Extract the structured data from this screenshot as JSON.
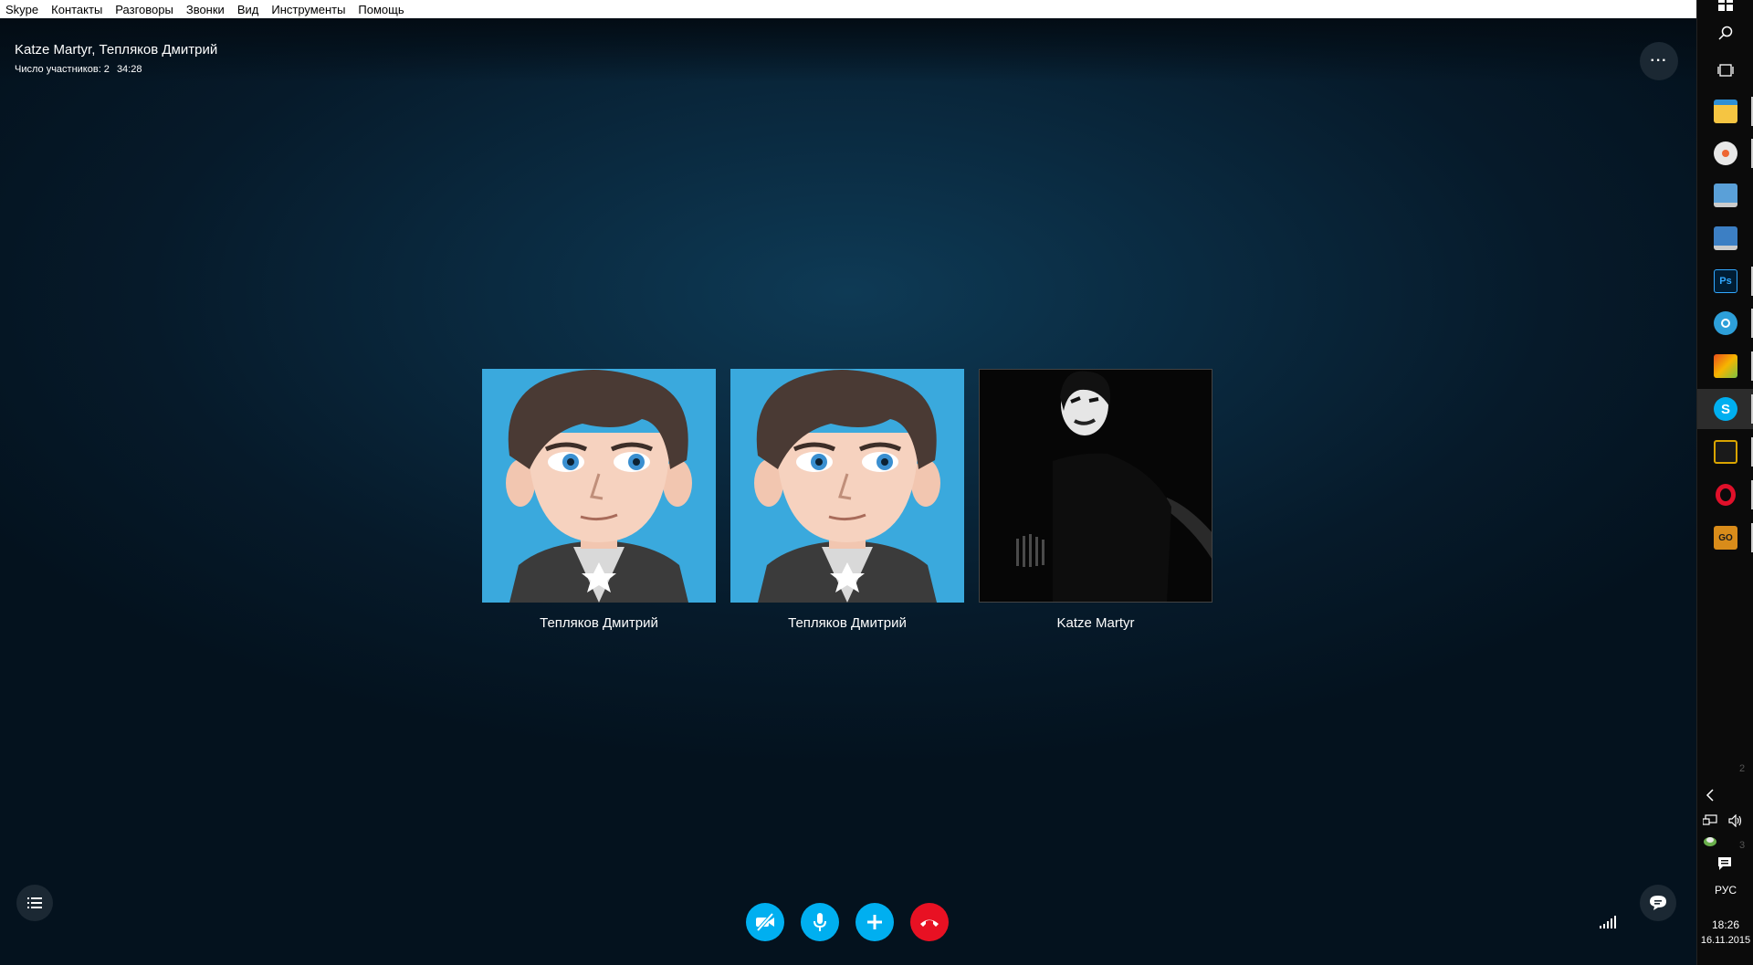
{
  "menubar": {
    "items": [
      {
        "label": "Skype"
      },
      {
        "label": "Контакты"
      },
      {
        "label": "Разговоры"
      },
      {
        "label": "Звонки"
      },
      {
        "label": "Вид"
      },
      {
        "label": "Инструменты"
      },
      {
        "label": "Помощь"
      }
    ]
  },
  "call": {
    "title": "Katze Martyr, Тепляков Дмитрий",
    "participants_count_label": "Число участников: 2",
    "duration": "34:28",
    "more_label": "···"
  },
  "participants": [
    {
      "name": "Тепляков Дмитрий",
      "avatar": "cartoon-boy-avatar"
    },
    {
      "name": "Тепляков Дмитрий",
      "avatar": "cartoon-boy-avatar"
    },
    {
      "name": "Katze Martyr",
      "avatar": "dark-photo-avatar"
    }
  ],
  "controls": {
    "video": {
      "icon": "video-off-icon",
      "state": "off"
    },
    "mic": {
      "icon": "microphone-icon",
      "state": "on"
    },
    "add": {
      "icon": "plus-icon"
    },
    "end": {
      "icon": "hang-up-icon"
    },
    "list": {
      "icon": "list-icon"
    },
    "signal": {
      "icon": "signal-bars-icon"
    },
    "chat": {
      "icon": "chat-icon"
    }
  },
  "colors": {
    "accent": "#00aff0",
    "end_call": "#e81123",
    "background": "#061a2a",
    "avatar_bg": "#3aa9dd"
  },
  "taskbar": {
    "apps": [
      {
        "icon": "task-view-icon"
      },
      {
        "icon": "file-explorer-icon"
      },
      {
        "icon": "paint-icon"
      },
      {
        "icon": "computer-icon"
      },
      {
        "icon": "network-computer-icon"
      },
      {
        "icon": "photoshop-icon",
        "label": "Ps"
      },
      {
        "icon": "app-gear-icon"
      },
      {
        "icon": "colorful-app-icon"
      },
      {
        "icon": "skype-icon",
        "label": "S"
      },
      {
        "icon": "tools-icon"
      },
      {
        "icon": "opera-icon"
      },
      {
        "icon": "csgo-icon",
        "label": "GO"
      }
    ],
    "language": "РУС",
    "time": "18:26",
    "date": "16.11.2015",
    "side_numbers": [
      "2",
      "3"
    ]
  }
}
